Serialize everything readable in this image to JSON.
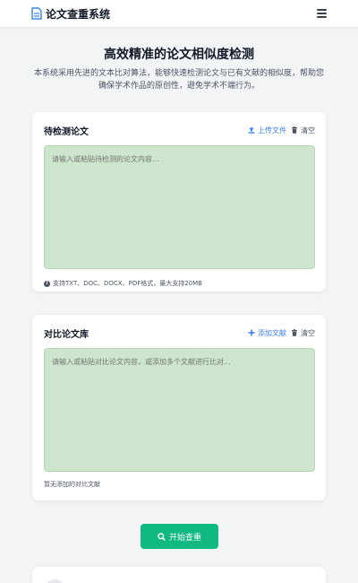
{
  "header": {
    "title": "论文查重系统",
    "brand_icon": "file-document-icon",
    "menu_icon": "hamburger-menu-icon"
  },
  "hero": {
    "title": "高效精准的论文相似度检测",
    "description": "本系统采用先进的文本比对算法，能够快速检测论文与已有文献的相似度，帮助您确保学术作品的原创性，避免学术不端行为。"
  },
  "check_paper": {
    "title": "待检测论文",
    "upload_label": "上传文件",
    "clear_label": "清空",
    "placeholder": "请输入或粘贴待检测的论文内容...",
    "hint": "支持TXT、DOC、DOCX、PDF格式，最大支持20MB"
  },
  "compare_library": {
    "title": "对比论文库",
    "add_label": "添加文献",
    "clear_label": "清空",
    "placeholder": "请输入或粘贴对比论文内容，或添加多个文献进行比对...",
    "empty_note": "暂无添加的对比文献"
  },
  "start_button": {
    "label": "开始查重",
    "icon": "search-icon"
  },
  "colors": {
    "accent": "#3b82f6",
    "primary_button": "#10b981",
    "textarea_bg": "#cce5cc"
  }
}
